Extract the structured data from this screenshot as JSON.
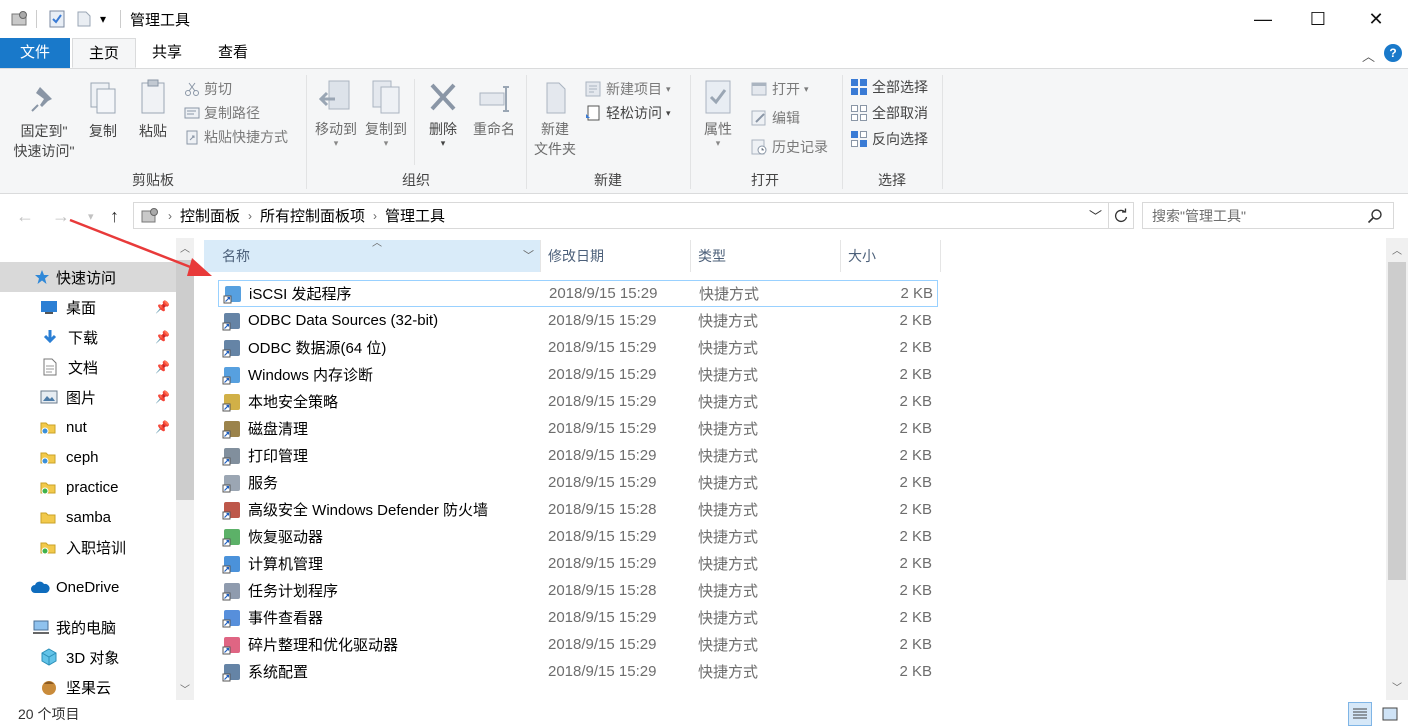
{
  "window": {
    "title": "管理工具",
    "qa_dropdown": "▾",
    "min_label": "—",
    "max_label": "☐",
    "close_label": "✕"
  },
  "tabs": {
    "file": "文件",
    "home": "主页",
    "share": "共享",
    "view": "查看"
  },
  "ribbon": {
    "clipboard": {
      "pin_line1": "固定到\"",
      "pin_line2": "快速访问\"",
      "copy": "复制",
      "paste": "粘贴",
      "cut": "剪切",
      "copy_path": "复制路径",
      "paste_shortcut": "粘贴快捷方式",
      "label": "剪贴板"
    },
    "organize": {
      "move_to": "移动到",
      "copy_to": "复制到",
      "delete": "删除",
      "rename": "重命名",
      "label": "组织"
    },
    "new": {
      "new_folder_line1": "新建",
      "new_folder_line2": "文件夹",
      "new_item": "新建项目",
      "easy_access": "轻松访问",
      "label": "新建"
    },
    "open": {
      "properties": "属性",
      "open": "打开",
      "edit": "编辑",
      "history": "历史记录",
      "label": "打开"
    },
    "select": {
      "select_all": "全部选择",
      "select_none": "全部取消",
      "invert": "反向选择",
      "label": "选择"
    }
  },
  "address": {
    "crumbs": [
      "控制面板",
      "所有控制面板项",
      "管理工具"
    ],
    "search_placeholder": "搜索\"管理工具\""
  },
  "nav": {
    "items": [
      {
        "label": "快速访问",
        "icon": "star-icon"
      },
      {
        "label": "桌面",
        "icon": "desktop-icon"
      },
      {
        "label": "下载",
        "icon": "download-icon"
      },
      {
        "label": "文档",
        "icon": "document-icon"
      },
      {
        "label": "图片",
        "icon": "pictures-icon"
      },
      {
        "label": "nut",
        "icon": "folder-icon"
      },
      {
        "label": "ceph",
        "icon": "folder-icon"
      },
      {
        "label": "practice",
        "icon": "folder-icon"
      },
      {
        "label": "samba",
        "icon": "folder-icon"
      },
      {
        "label": "入职培训",
        "icon": "folder-icon"
      },
      {
        "label": "OneDrive",
        "icon": "cloud-icon"
      },
      {
        "label": "我的电脑",
        "icon": "computer-icon"
      },
      {
        "label": "3D 对象",
        "icon": "cube-icon"
      },
      {
        "label": "坚果云",
        "icon": "nut-icon"
      }
    ]
  },
  "columns": {
    "name": "名称",
    "date": "修改日期",
    "type": "类型",
    "size": "大小"
  },
  "files": [
    {
      "name": "iSCSI 发起程序",
      "date": "2018/9/15 15:29",
      "type": "快捷方式",
      "size": "2 KB"
    },
    {
      "name": "ODBC Data Sources (32-bit)",
      "date": "2018/9/15 15:29",
      "type": "快捷方式",
      "size": "2 KB"
    },
    {
      "name": "ODBC 数据源(64 位)",
      "date": "2018/9/15 15:29",
      "type": "快捷方式",
      "size": "2 KB"
    },
    {
      "name": "Windows 内存诊断",
      "date": "2018/9/15 15:29",
      "type": "快捷方式",
      "size": "2 KB"
    },
    {
      "name": "本地安全策略",
      "date": "2018/9/15 15:29",
      "type": "快捷方式",
      "size": "2 KB"
    },
    {
      "name": "磁盘清理",
      "date": "2018/9/15 15:29",
      "type": "快捷方式",
      "size": "2 KB"
    },
    {
      "name": "打印管理",
      "date": "2018/9/15 15:29",
      "type": "快捷方式",
      "size": "2 KB"
    },
    {
      "name": "服务",
      "date": "2018/9/15 15:29",
      "type": "快捷方式",
      "size": "2 KB"
    },
    {
      "name": "高级安全 Windows Defender 防火墙",
      "date": "2018/9/15 15:28",
      "type": "快捷方式",
      "size": "2 KB"
    },
    {
      "name": "恢复驱动器",
      "date": "2018/9/15 15:29",
      "type": "快捷方式",
      "size": "2 KB"
    },
    {
      "name": "计算机管理",
      "date": "2018/9/15 15:29",
      "type": "快捷方式",
      "size": "2 KB"
    },
    {
      "name": "任务计划程序",
      "date": "2018/9/15 15:28",
      "type": "快捷方式",
      "size": "2 KB"
    },
    {
      "name": "事件查看器",
      "date": "2018/9/15 15:29",
      "type": "快捷方式",
      "size": "2 KB"
    },
    {
      "name": "碎片整理和优化驱动器",
      "date": "2018/9/15 15:29",
      "type": "快捷方式",
      "size": "2 KB"
    },
    {
      "name": "系统配置",
      "date": "2018/9/15 15:29",
      "type": "快捷方式",
      "size": "2 KB"
    }
  ],
  "status": {
    "count": "20 个项目"
  },
  "colors": {
    "accent": "#1979ca",
    "annotation_arrow": "#e83a3a"
  }
}
